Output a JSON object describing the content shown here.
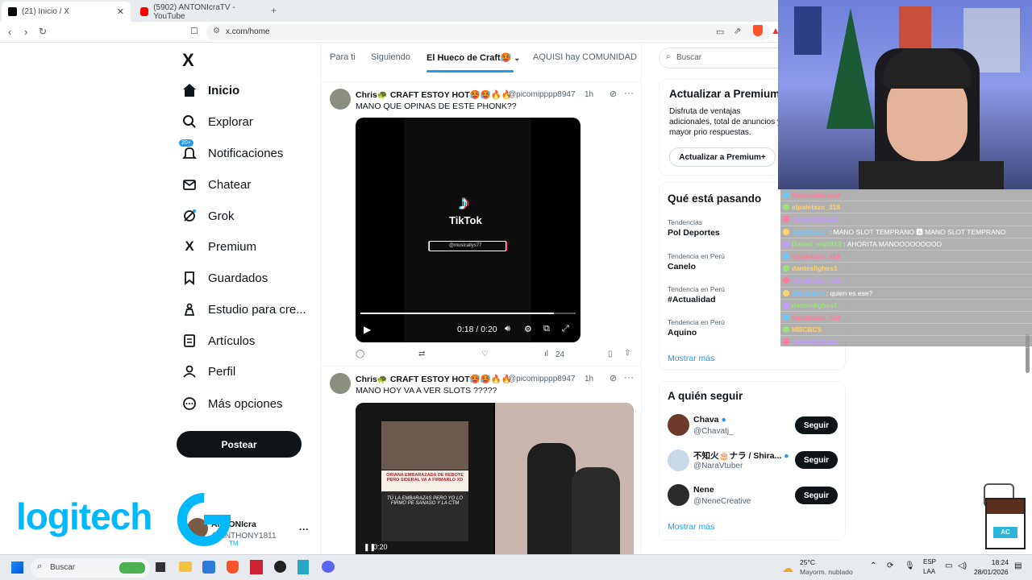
{
  "browser": {
    "tabs": [
      {
        "label": "(21) Inicio / X",
        "active": true,
        "favicon_color": "#000000"
      },
      {
        "label": "(5902) ANTONIcraTV - YouTube",
        "active": false,
        "favicon_color": "#ff0000"
      }
    ],
    "new_tab": "+",
    "url": "x.com/home"
  },
  "sidebar": {
    "logo": "X",
    "items": [
      {
        "label": "Inicio",
        "icon": "home-icon",
        "active": true
      },
      {
        "label": "Explorar",
        "icon": "search-icon"
      },
      {
        "label": "Notificaciones",
        "icon": "bell-icon",
        "badge": "20+"
      },
      {
        "label": "Chatear",
        "icon": "mail-icon"
      },
      {
        "label": "Grok",
        "icon": "grok-icon"
      },
      {
        "label": "Premium",
        "icon": "x-premium-icon"
      },
      {
        "label": "Guardados",
        "icon": "bookmark-icon"
      },
      {
        "label": "Estudio para cre...",
        "icon": "studio-icon"
      },
      {
        "label": "Artículos",
        "icon": "articles-icon"
      },
      {
        "label": "Perfil",
        "icon": "profile-icon"
      },
      {
        "label": "Más opciones",
        "icon": "more-circle-icon"
      }
    ],
    "post_button": "Postear",
    "account": {
      "name": "ANTONIcra",
      "handle": "@ANTHONY1811"
    }
  },
  "feed": {
    "tabs": [
      "Para ti",
      "Siguiendo",
      "El Hueco de Craft🥵",
      "AQUISI hay COMUNIDAD"
    ],
    "active_tab": 2,
    "tweets": [
      {
        "name": "Chris🐢 CRAFT ESTOY HOT🥵🥵🔥🔥",
        "handle": "@picomipppp8947",
        "time": "1h",
        "text": "MANO QUE OPINAS DE ESTE PHONK??",
        "video": {
          "brand": "TikTok",
          "user": "@musicallys77",
          "time": "0:18 / 0:20",
          "progress": 0.9
        },
        "reply_count": "",
        "views": "24"
      },
      {
        "name": "Chris🐢 CRAFT ESTOY HOT🥵🥵🔥🔥",
        "handle": "@picomipppp8947",
        "time": "1h",
        "text": "MANO HOY VA A VER SLOTS ?????",
        "media_caption_1": "ORIANA EMBARAZADA DE REBOTE PERO SIDERAL VA A FIRMARLO XD",
        "media_caption_2": "TÚ LA EMBARAZAS PERO YO LO FIRMO PE SANASO Y LA CTM",
        "video_time": "0:20"
      }
    ]
  },
  "right": {
    "search_placeholder": "Buscar",
    "premium": {
      "title": "Actualizar a Premium",
      "body": "Disfruta de ventajas adicionales, total de anuncios y mayor prio respuestas.",
      "button": "Actualizar a Premium+"
    },
    "trending": {
      "title": "Qué está pasando",
      "items": [
        {
          "category": "Tendencias",
          "name": "Pol Deportes"
        },
        {
          "category": "Tendencia en Perú",
          "name": "Canelo"
        },
        {
          "category": "Tendencia en Perú",
          "name": "#Actualidad"
        },
        {
          "category": "Tendencia en Perú",
          "name": "Aquino"
        }
      ],
      "more": "Mostrar más"
    },
    "who_to_follow": {
      "title": "A quién seguir",
      "users": [
        {
          "name": "Chava",
          "handle": "@Chavatj_",
          "button": "Seguir",
          "avatar_color": "#6b3a2a"
        },
        {
          "name": "不知火🎂ナラ / Shira...",
          "handle": "@NaraVtuber",
          "button": "Seguir",
          "avatar_color": "#c9d8e8"
        },
        {
          "name": "Nene",
          "handle": "@NeneCreative",
          "button": "Seguir",
          "avatar_color": "#2b2b2b"
        }
      ],
      "more": "Mostrar más"
    }
  },
  "chat": [
    {
      "user": "MadnesRanger",
      "msg": ""
    },
    {
      "user": "elpaletazo_318",
      "msg": ""
    },
    {
      "user": "danteslighes1",
      "msg": ""
    },
    {
      "user": "alejo0nd07",
      "msg": "MANO SLOT TEMPRANO 🅰 MANO SLOT TEMPRANO"
    },
    {
      "user": "Daniel_mij0313",
      "msg": "AHORITA MANOOOOOOOOO"
    },
    {
      "user": "elpaletazo_318",
      "msg": ""
    },
    {
      "user": "danteslighes1",
      "msg": ""
    },
    {
      "user": "elpaletazo_318",
      "msg": ""
    },
    {
      "user": "SrSmokin",
      "msg": "quien es ese?"
    },
    {
      "user": "danteslighes1",
      "msg": ""
    },
    {
      "user": "elpaletazo_318",
      "msg": ""
    },
    {
      "user": "MBCBCS",
      "msg": ""
    },
    {
      "user": "danteslighes1",
      "msg": ""
    }
  ],
  "overlay": {
    "logitech": "logitech",
    "tm": "TM",
    "streamer_tag": "AC"
  },
  "taskbar": {
    "search": "Buscar",
    "weather_temp": "25°C",
    "weather_desc": "Mayorm. nublado",
    "lang_top": "ESP",
    "lang_bottom": "LAA",
    "time": "18:24",
    "date": "28/01/2026"
  }
}
